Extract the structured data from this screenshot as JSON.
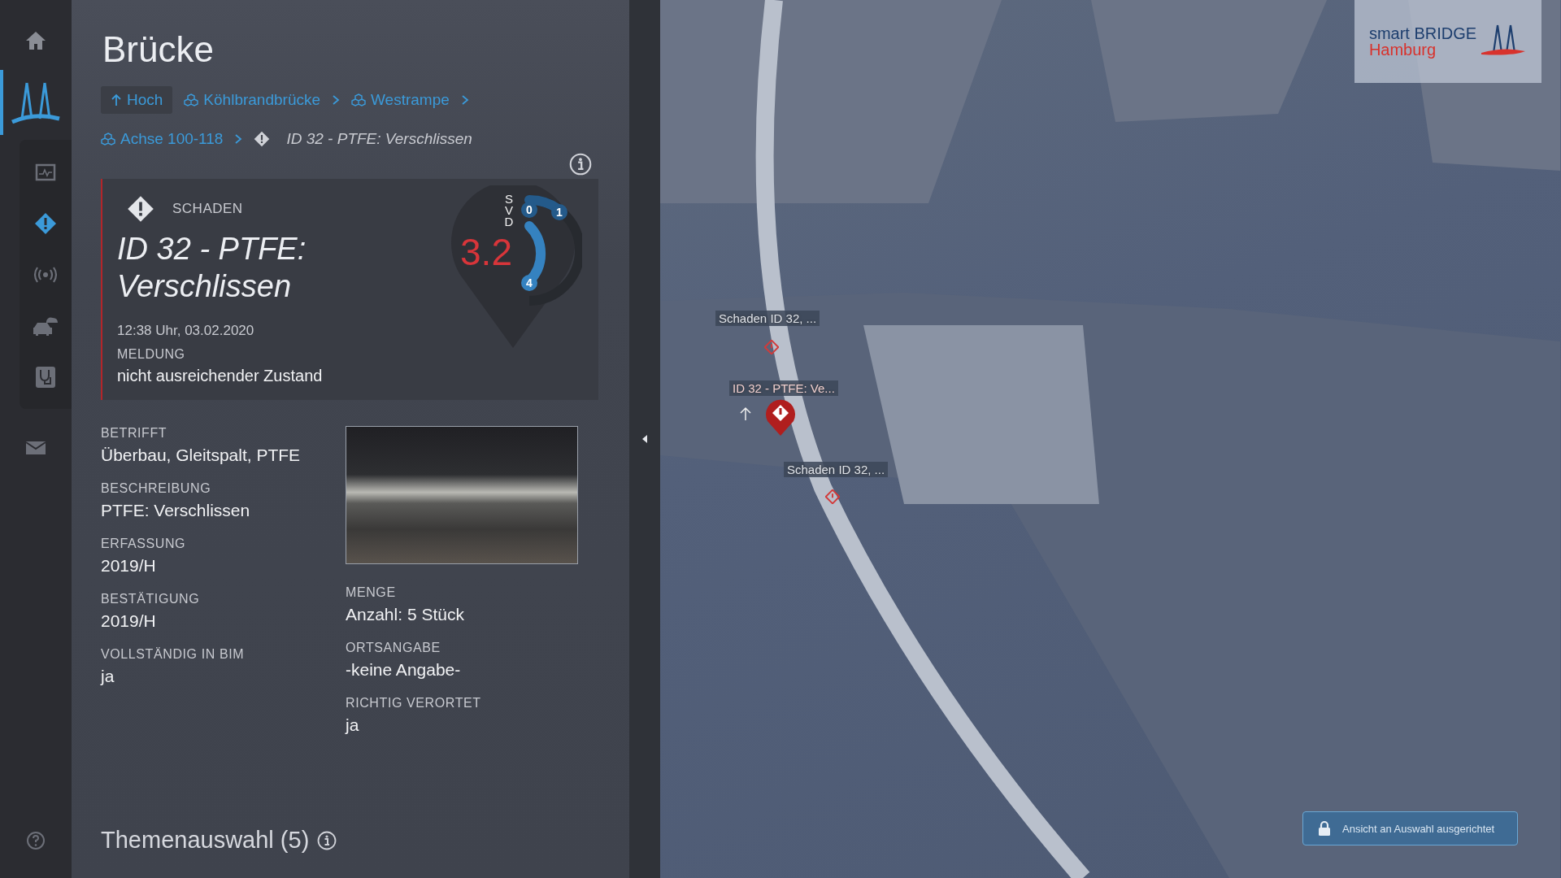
{
  "nav": {
    "top": [
      {
        "kind": "home",
        "selected": false
      },
      {
        "kind": "bridge",
        "selected": true
      }
    ],
    "layers": [
      {
        "kind": "monitoring",
        "on": false
      },
      {
        "kind": "damage",
        "on": true
      },
      {
        "kind": "sensor",
        "on": false
      },
      {
        "kind": "traffic",
        "on": false
      },
      {
        "kind": "health",
        "on": false
      }
    ],
    "bottom": [
      {
        "kind": "mail"
      },
      {
        "kind": "help"
      }
    ]
  },
  "panel": {
    "title": "Brücke",
    "breadcrumb": [
      {
        "kind": "up",
        "label": "Hoch"
      },
      {
        "kind": "part",
        "label": "Köhlbrandbrücke"
      },
      {
        "kind": "part",
        "label": "Westrampe"
      },
      {
        "kind": "part",
        "label": "Achse 100-118"
      },
      {
        "kind": "current",
        "label": "ID 32 - PTFE: Verschlissen"
      }
    ],
    "card": {
      "category": "SCHADEN",
      "title": "ID 32 - PTFE: Verschlissen",
      "timestamp": "12:38 Uhr, 03.02.2020",
      "message_label": "MELDUNG",
      "message": "nicht ausreichender Zustand",
      "gauge": {
        "letters": [
          "S",
          "V",
          "D"
        ],
        "value": "3.2",
        "marks": [
          "0",
          "1",
          "4"
        ]
      }
    },
    "details_left": [
      {
        "label": "BETRIFFT",
        "value": "Überbau, Gleitspalt, PTFE"
      },
      {
        "label": "BESCHREIBUNG",
        "value": "PTFE: Verschlissen"
      },
      {
        "label": "ERFASSUNG",
        "value": "2019/H"
      },
      {
        "label": "BESTÄTIGUNG",
        "value": "2019/H"
      },
      {
        "label": "VOLLSTÄNDIG IN BIM",
        "value": "ja"
      }
    ],
    "details_right": [
      {
        "label": "MENGE",
        "value": "Anzahl: 5 Stück"
      },
      {
        "label": "ORTSANGABE",
        "value": "-keine Angabe-"
      },
      {
        "label": "RICHTIG VERORTET",
        "value": "ja"
      }
    ],
    "section": "Themenauswahl (5)"
  },
  "map": {
    "labels": [
      {
        "text": "Schaden ID 32, ...",
        "kind": "minor"
      },
      {
        "text": "ID 32 - PTFE: Ve...",
        "kind": "major"
      },
      {
        "text": "Schaden ID 32, ...",
        "kind": "minor"
      }
    ],
    "logo": {
      "line1": "smart BRIDGE",
      "line2": "Hamburg"
    },
    "lock_button": "Ansicht an Auswahl ausgerichtet"
  }
}
